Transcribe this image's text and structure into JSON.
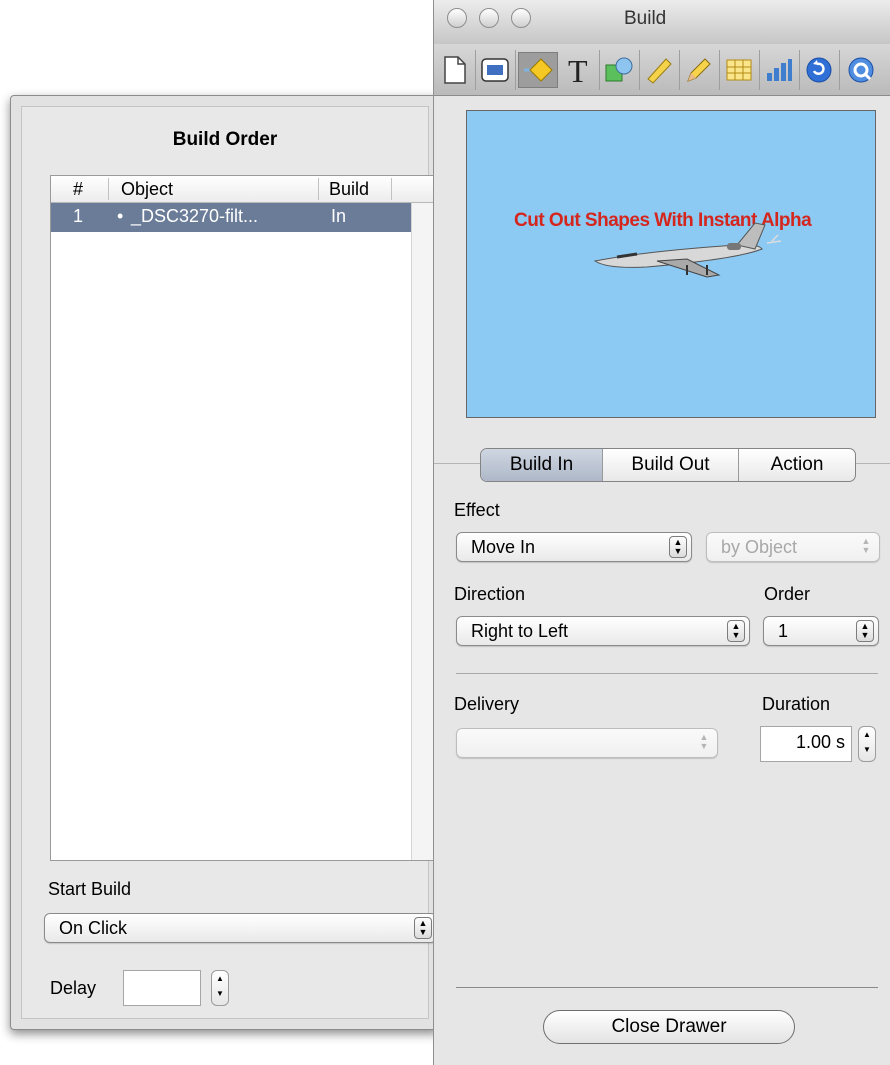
{
  "drawer": {
    "title": "Build Order",
    "table": {
      "columns": [
        "#",
        "Object",
        "Build"
      ],
      "rows": [
        {
          "num": "1",
          "bullet": "•",
          "object": "_DSC3270-filt...",
          "build": "In"
        }
      ]
    },
    "start_build": {
      "label": "Start Build",
      "value": "On Click"
    },
    "delay": {
      "label": "Delay",
      "value": ""
    }
  },
  "window": {
    "title": "Build",
    "toolbar": [
      "document-icon",
      "slide-icon",
      "build-icon",
      "text-icon",
      "graphic-icon",
      "metrics-icon",
      "table-icon",
      "chart-icon",
      "hyperlink-icon",
      "quicktime-icon"
    ],
    "preview": {
      "text": "Cut Out Shapes With Instant Alpha",
      "background": "#8ccaf4",
      "text_color": "#d5261e"
    },
    "tabs": [
      {
        "label": "Build In",
        "active": true
      },
      {
        "label": "Build Out",
        "active": false
      },
      {
        "label": "Action",
        "active": false
      }
    ],
    "effect": {
      "label": "Effect",
      "value": "Move In",
      "by_value": "by Object"
    },
    "direction": {
      "label": "Direction",
      "value": "Right to Left"
    },
    "order": {
      "label": "Order",
      "value": "1"
    },
    "delivery": {
      "label": "Delivery",
      "value": ""
    },
    "duration": {
      "label": "Duration",
      "value": "1.00 s"
    },
    "close_button": "Close Drawer"
  }
}
